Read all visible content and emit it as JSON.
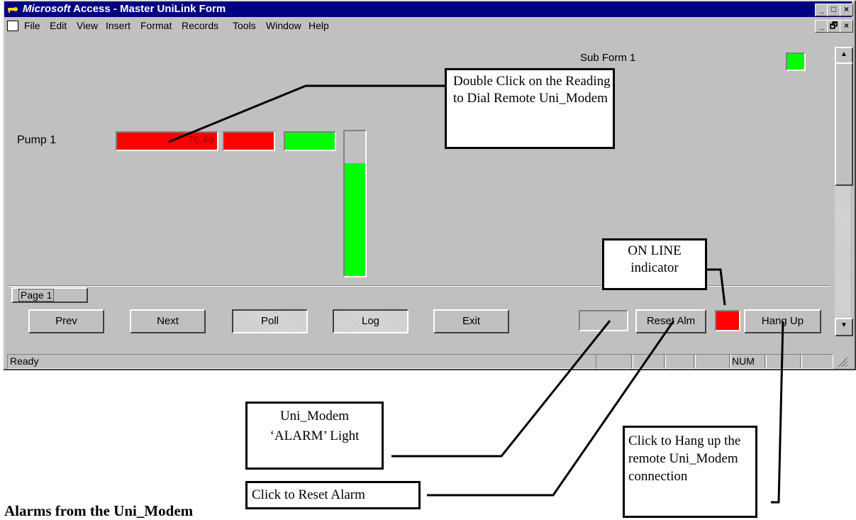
{
  "window": {
    "title_brand": "Microsoft",
    "title_rest": " Access - Master UniLink Form",
    "caption_buttons": [
      "_",
      "□",
      "×"
    ]
  },
  "menu": {
    "items": [
      "File",
      "Edit",
      "View",
      "Insert",
      "Format",
      "Records",
      "Tools",
      "Window",
      "Help"
    ],
    "doc_buttons": [
      "_",
      "🗗",
      "×"
    ]
  },
  "form": {
    "subform_label": "Sub Form 1",
    "pump_label": "Pump 1",
    "reading": "76.49",
    "level_fraction": 0.78,
    "page_tab": "Page 1",
    "buttons": {
      "prev": "Prev",
      "next": "Next",
      "poll": "Poll",
      "log": "Log",
      "exit": "Exit",
      "reset_alm": "Reset Alm",
      "hang_up": "Hang Up"
    }
  },
  "status": {
    "text": "Ready",
    "num": "NUM"
  },
  "callouts": {
    "dial": "Double Click on the Reading to Dial Remote Uni_Modem",
    "online": "ON LINE indicator",
    "alarm_light": "Uni_Modem ‘ALARM’ Light",
    "reset": "Click to Reset Alarm",
    "hangup": "Click to Hang up the remote Uni_Modem connection"
  },
  "heading": "Alarms from the Uni_Modem",
  "colors": {
    "titlebar": "#000080",
    "red": "#ff0000",
    "green": "#00ff00",
    "face": "#c0c0c0"
  }
}
